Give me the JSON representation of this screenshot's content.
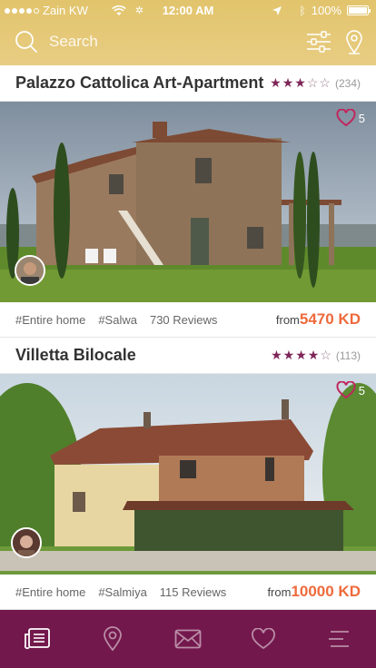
{
  "status_bar": {
    "carrier": "Zain KW",
    "time": "12:00 AM",
    "battery": "100%"
  },
  "search": {
    "placeholder": "Search"
  },
  "listings": [
    {
      "title": "Palazzo Cattolica Art-Apartment",
      "rating": 3,
      "rating_count": "(234)",
      "likes": "5",
      "tags": [
        "#Entire home",
        "#Salwa",
        "730 Reviews"
      ],
      "price_prefix": "from",
      "price": "5470 KD"
    },
    {
      "title": "Villetta Bilocale",
      "rating": 4,
      "rating_count": "(113)",
      "likes": "5",
      "tags": [
        "#Entire home",
        "#Salmiya",
        "115 Reviews"
      ],
      "price_prefix": "from",
      "price": "10000 KD"
    }
  ],
  "tabbar": {
    "items": [
      "listings-icon",
      "map-pin-icon",
      "mail-icon",
      "heart-icon",
      "menu-icon"
    ],
    "active": 0
  },
  "colors": {
    "header": "#e2c46c",
    "accent": "#7e2659",
    "price": "#ee6a3c",
    "tabbar": "#73184c"
  }
}
